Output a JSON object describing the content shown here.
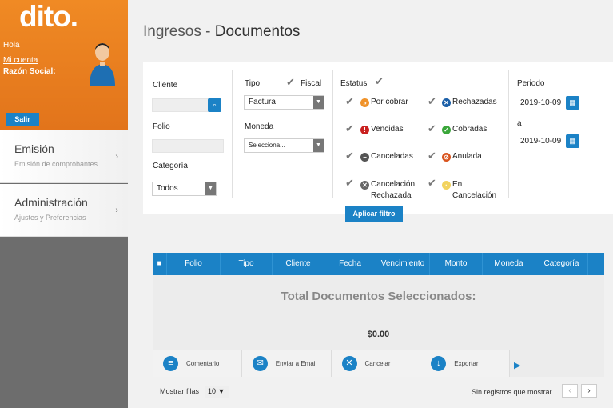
{
  "brand": {
    "logo": "dito."
  },
  "user": {
    "greeting": "Hola",
    "account_link": "Mi cuenta",
    "razon_label": "Razón Social:",
    "logout": "Salir"
  },
  "sidebar": {
    "items": [
      {
        "title": "Emisión",
        "subtitle": "Emisión de comprobantes"
      },
      {
        "title": "Administración",
        "subtitle": "Ajustes y Preferencias"
      }
    ]
  },
  "page": {
    "title_prefix": "Ingresos - ",
    "title_main": "Documentos"
  },
  "filters": {
    "cliente_label": "Cliente",
    "folio_label": "Folio",
    "categoria_label": "Categoría",
    "categoria_value": "Todos",
    "tipo_label": "Tipo",
    "fiscal_label": "Fiscal",
    "tipo_value": "Factura",
    "moneda_label": "Moneda",
    "moneda_value": "Selecciona...",
    "estatus_label": "Estatus",
    "statuses": [
      "Por cobrar",
      "Rechazadas",
      "Vencidas",
      "Cobradas",
      "Canceladas",
      "Anulada",
      "Cancelación",
      "Rechazada",
      "En",
      "Cancelación"
    ],
    "periodo_label": "Periodo",
    "date_from": "2019-10-09",
    "a_label": "a",
    "date_to": "2019-10-09",
    "apply_button": "Aplicar filtro"
  },
  "table": {
    "columns": [
      "Folio",
      "Tipo",
      "Cliente",
      "Fecha",
      "Vencimiento",
      "Monto",
      "Moneda",
      "Categoría"
    ],
    "total_label": "Total Documentos Seleccionados:",
    "total_amount": "$0.00",
    "actions": [
      "Comentario",
      "Enviar a Email",
      "Cancelar",
      "Exportar"
    ]
  },
  "footer": {
    "show_rows_label": "Mostrar filas",
    "rows_value": "10",
    "no_records": "Sin registros que mostrar"
  },
  "colors": {
    "accent": "#1b82c6",
    "brand_orange": "#ea7d20"
  }
}
